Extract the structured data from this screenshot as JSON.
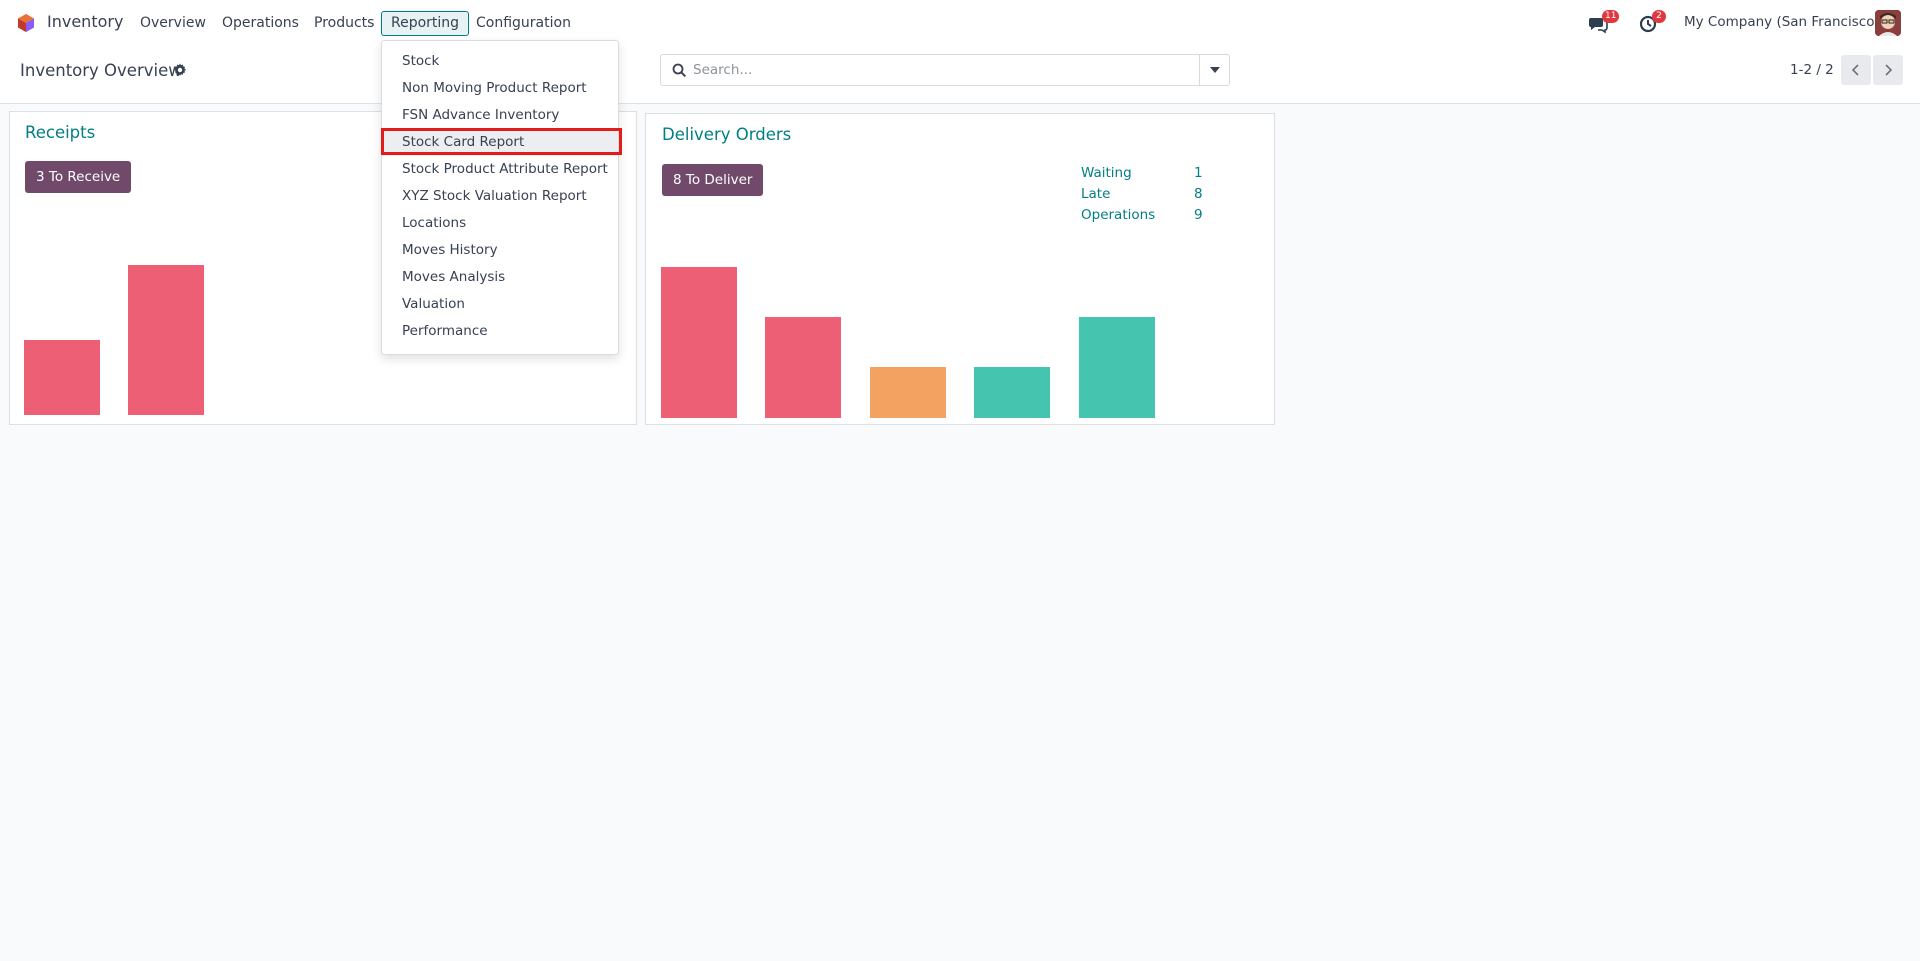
{
  "app": {
    "name": "Inventory",
    "menu": [
      "Overview",
      "Operations",
      "Products",
      "Reporting",
      "Configuration"
    ],
    "active_menu": "Reporting"
  },
  "systray": {
    "messages_count": "11",
    "activities_count": "2",
    "company": "My Company (San Francisco)"
  },
  "control_panel": {
    "title": "Inventory Overview",
    "search_placeholder": "Search...",
    "pager": "1-2 / 2"
  },
  "reporting_menu": {
    "items": [
      "Stock",
      "Non Moving Product Report",
      "FSN Advance Inventory",
      "Stock Card Report",
      "Stock Product Attribute Report",
      "XYZ Stock Valuation Report",
      "Locations",
      "Moves History",
      "Moves Analysis",
      "Valuation",
      "Performance"
    ],
    "highlighted_item": "Stock Card Report"
  },
  "cards": {
    "receipts": {
      "title": "Receipts",
      "button": "3 To Receive",
      "bar_colors": [
        "#ec5f74",
        "#ec5f74"
      ]
    },
    "delivery": {
      "title": "Delivery Orders",
      "button": "8 To Deliver",
      "stats": [
        {
          "label": "Waiting",
          "value": "1"
        },
        {
          "label": "Late",
          "value": "8"
        },
        {
          "label": "Operations",
          "value": "9"
        }
      ],
      "bar_colors": [
        "#ec5f74",
        "#ec5f74",
        "#f4a261",
        "#45c4b0",
        "#45c4b0"
      ]
    }
  },
  "colors": {
    "accent": "#017e84",
    "button": "#71496b",
    "highlight_border": "#e21b1b"
  }
}
